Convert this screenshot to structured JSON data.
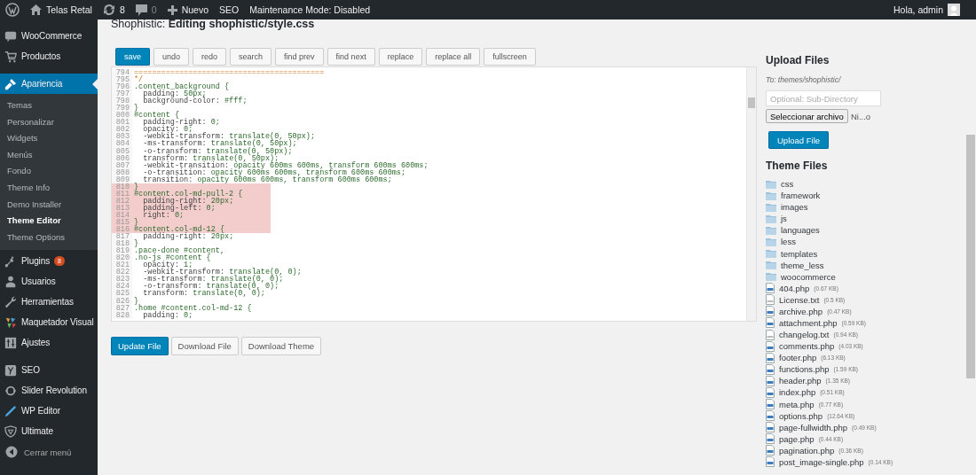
{
  "admin_bar": {
    "items": [
      {
        "kind": "logo"
      },
      {
        "kind": "site",
        "label": "Telas Retal"
      },
      {
        "kind": "updates",
        "label": "8"
      },
      {
        "kind": "comments",
        "label": "0"
      },
      {
        "kind": "new",
        "label": "Nuevo"
      },
      {
        "kind": "text",
        "label": "SEO"
      },
      {
        "kind": "text",
        "label": "Maintenance Mode: Disabled"
      }
    ],
    "greeting": "Hola, admin"
  },
  "sidebar": {
    "items": [
      {
        "label": "WooCommerce",
        "selected": false
      },
      {
        "label": "Productos",
        "selected": false
      },
      {
        "label": "Apariencia",
        "selected": true,
        "children": [
          {
            "label": "Temas",
            "selected": false
          },
          {
            "label": "Personalizar",
            "selected": false
          },
          {
            "label": "Widgets",
            "selected": false
          },
          {
            "label": "Menús",
            "selected": false
          },
          {
            "label": "Fondo",
            "selected": false
          },
          {
            "label": "Theme Info",
            "selected": false
          },
          {
            "label": "Demo Installer",
            "selected": false
          },
          {
            "label": "Theme Editor",
            "selected": true
          },
          {
            "label": "Theme Options",
            "selected": false
          }
        ]
      },
      {
        "label": "Plugins",
        "selected": false,
        "badge": "8"
      },
      {
        "label": "Usuarios",
        "selected": false
      },
      {
        "label": "Herramientas",
        "selected": false
      },
      {
        "label": "Maquetador Visual",
        "selected": false
      },
      {
        "label": "Ajustes",
        "selected": false
      },
      {
        "label": "SEO",
        "selected": false,
        "separator_before": true
      },
      {
        "label": "Slider Revolution",
        "selected": false
      },
      {
        "label": "WP Editor",
        "selected": false
      },
      {
        "label": "Ultimate",
        "selected": false
      }
    ],
    "collapse": "Cerrar menú"
  },
  "page_title": "Shophistic: **Editing shophistic/style.css**",
  "toolbar": [
    {
      "label": "save",
      "kind": "primary"
    },
    {
      "label": "undo",
      "kind": "default"
    },
    {
      "label": "redo",
      "kind": "default"
    },
    {
      "label": "search",
      "kind": "default"
    },
    {
      "label": "find prev",
      "kind": "default"
    },
    {
      "label": "find next",
      "kind": "default"
    },
    {
      "label": "replace",
      "kind": "default"
    },
    {
      "label": "replace all",
      "kind": "default"
    },
    {
      "label": "fullscreen",
      "kind": "default"
    }
  ],
  "code": {
    "lines": [
      {
        "number": "794",
        "text": "==========================================",
        "kind": "comment",
        "highlighted": false
      },
      {
        "number": "795",
        "text": "*/",
        "kind": "comment",
        "highlighted": false
      },
      {
        "number": "796",
        "text": ".content_background {",
        "kind": "code",
        "highlighted": false
      },
      {
        "number": "797",
        "text": "  padding: 50px;",
        "kind": "code",
        "highlighted": false
      },
      {
        "number": "798",
        "text": "  background-color: #fff;",
        "kind": "code",
        "highlighted": false
      },
      {
        "number": "799",
        "text": "}",
        "kind": "code",
        "highlighted": false
      },
      {
        "number": "800",
        "text": "#content {",
        "kind": "code",
        "highlighted": false
      },
      {
        "number": "801",
        "text": "  padding-right: 0;",
        "kind": "code",
        "highlighted": false
      },
      {
        "number": "802",
        "text": "  opacity: 0;",
        "kind": "code",
        "highlighted": false
      },
      {
        "number": "803",
        "text": "  -webkit-transform: translate(0, 50px);",
        "kind": "code",
        "highlighted": false
      },
      {
        "number": "804",
        "text": "  -ms-transform: translate(0, 50px);",
        "kind": "code",
        "highlighted": false
      },
      {
        "number": "805",
        "text": "  -o-transform: translate(0, 50px);",
        "kind": "code",
        "highlighted": false
      },
      {
        "number": "806",
        "text": "  transform: translate(0, 50px);",
        "kind": "code",
        "highlighted": false
      },
      {
        "number": "807",
        "text": "  -webkit-transition: opacity 600ms 600ms, transform 600ms 600ms;",
        "kind": "code",
        "highlighted": false
      },
      {
        "number": "808",
        "text": "  -o-transition: opacity 600ms 600ms, transform 600ms 600ms;",
        "kind": "code",
        "highlighted": false
      },
      {
        "number": "809",
        "text": "  transition: opacity 600ms 600ms, transform 600ms 600ms;",
        "kind": "code",
        "highlighted": false
      },
      {
        "number": "810",
        "text": "}",
        "kind": "code",
        "highlighted": true
      },
      {
        "number": "811",
        "text": "#content.col-md-pull-2 {",
        "kind": "code",
        "highlighted": true
      },
      {
        "number": "812",
        "text": "  padding-right: 20px;",
        "kind": "code",
        "highlighted": true
      },
      {
        "number": "813",
        "text": "  padding-left: 0;",
        "kind": "code",
        "highlighted": true
      },
      {
        "number": "814",
        "text": "  right: 0;",
        "kind": "code",
        "highlighted": true
      },
      {
        "number": "815",
        "text": "}",
        "kind": "code",
        "highlighted": true
      },
      {
        "number": "816",
        "text": "#content.col-md-12 {",
        "kind": "code",
        "highlighted": true
      },
      {
        "number": "817",
        "text": "  padding-right: 20px;",
        "kind": "code",
        "highlighted": false
      },
      {
        "number": "818",
        "text": "}",
        "kind": "code",
        "highlighted": false
      },
      {
        "number": "819",
        "text": ".pace-done #content,",
        "kind": "code",
        "highlighted": false
      },
      {
        "number": "820",
        "text": ".no-js #content {",
        "kind": "code",
        "highlighted": false
      },
      {
        "number": "821",
        "text": "  opacity: 1;",
        "kind": "code",
        "highlighted": false
      },
      {
        "number": "822",
        "text": "  -webkit-transform: translate(0, 0);",
        "kind": "code",
        "highlighted": false
      },
      {
        "number": "823",
        "text": "  -ms-transform: translate(0, 0);",
        "kind": "code",
        "highlighted": false
      },
      {
        "number": "824",
        "text": "  -o-transform: translate(0, 0);",
        "kind": "code",
        "highlighted": false
      },
      {
        "number": "825",
        "text": "  transform: translate(0, 0);",
        "kind": "code",
        "highlighted": false
      },
      {
        "number": "826",
        "text": "}",
        "kind": "code",
        "highlighted": false
      },
      {
        "number": "827",
        "text": ".home #content.col-md-12 {",
        "kind": "code",
        "highlighted": false
      },
      {
        "number": "828",
        "text": "  padding: 0;",
        "kind": "code",
        "highlighted": false
      }
    ]
  },
  "actions": [
    {
      "label": "Update File",
      "kind": "primary"
    },
    {
      "label": "Download File",
      "kind": "default"
    },
    {
      "label": "Download Theme",
      "kind": "default"
    }
  ],
  "upload": {
    "title": "Upload Files",
    "path": "To: themes/shophistic/",
    "placeholder": "Optional: Sub-Directory",
    "file_button": "Seleccionar archivo",
    "file_status": "Ni...o",
    "button": "Upload File"
  },
  "theme_files": {
    "title": "Theme Files",
    "items": [
      {
        "kind": "folder",
        "name": "css"
      },
      {
        "kind": "folder",
        "name": "framework"
      },
      {
        "kind": "folder",
        "name": "images"
      },
      {
        "kind": "folder",
        "name": "js"
      },
      {
        "kind": "folder",
        "name": "languages"
      },
      {
        "kind": "folder",
        "name": "less"
      },
      {
        "kind": "folder",
        "name": "templates"
      },
      {
        "kind": "folder",
        "name": "theme_less"
      },
      {
        "kind": "folder",
        "name": "woocommerce"
      },
      {
        "kind": "php",
        "name": "404.php",
        "size": "(0.67 KB)"
      },
      {
        "kind": "txt",
        "name": "License.txt",
        "size": "(0.5 KB)"
      },
      {
        "kind": "php",
        "name": "archive.php",
        "size": "(0.47 KB)"
      },
      {
        "kind": "php",
        "name": "attachment.php",
        "size": "(0.59 KB)"
      },
      {
        "kind": "txt",
        "name": "changelog.txt",
        "size": "(0.94 KB)"
      },
      {
        "kind": "php",
        "name": "comments.php",
        "size": "(4.03 KB)"
      },
      {
        "kind": "php",
        "name": "footer.php",
        "size": "(6.13 KB)"
      },
      {
        "kind": "php",
        "name": "functions.php",
        "size": "(1.59 KB)"
      },
      {
        "kind": "php",
        "name": "header.php",
        "size": "(1.35 KB)"
      },
      {
        "kind": "php",
        "name": "index.php",
        "size": "(0.51 KB)"
      },
      {
        "kind": "php",
        "name": "meta.php",
        "size": "(0.77 KB)"
      },
      {
        "kind": "php",
        "name": "options.php",
        "size": "(12.64 KB)"
      },
      {
        "kind": "php",
        "name": "page-fullwidth.php",
        "size": "(0.49 KB)"
      },
      {
        "kind": "php",
        "name": "page.php",
        "size": "(0.44 KB)"
      },
      {
        "kind": "php",
        "name": "pagination.php",
        "size": "(0.36 KB)"
      },
      {
        "kind": "php",
        "name": "post_image-single.php",
        "size": "(0.14 KB)"
      }
    ]
  }
}
